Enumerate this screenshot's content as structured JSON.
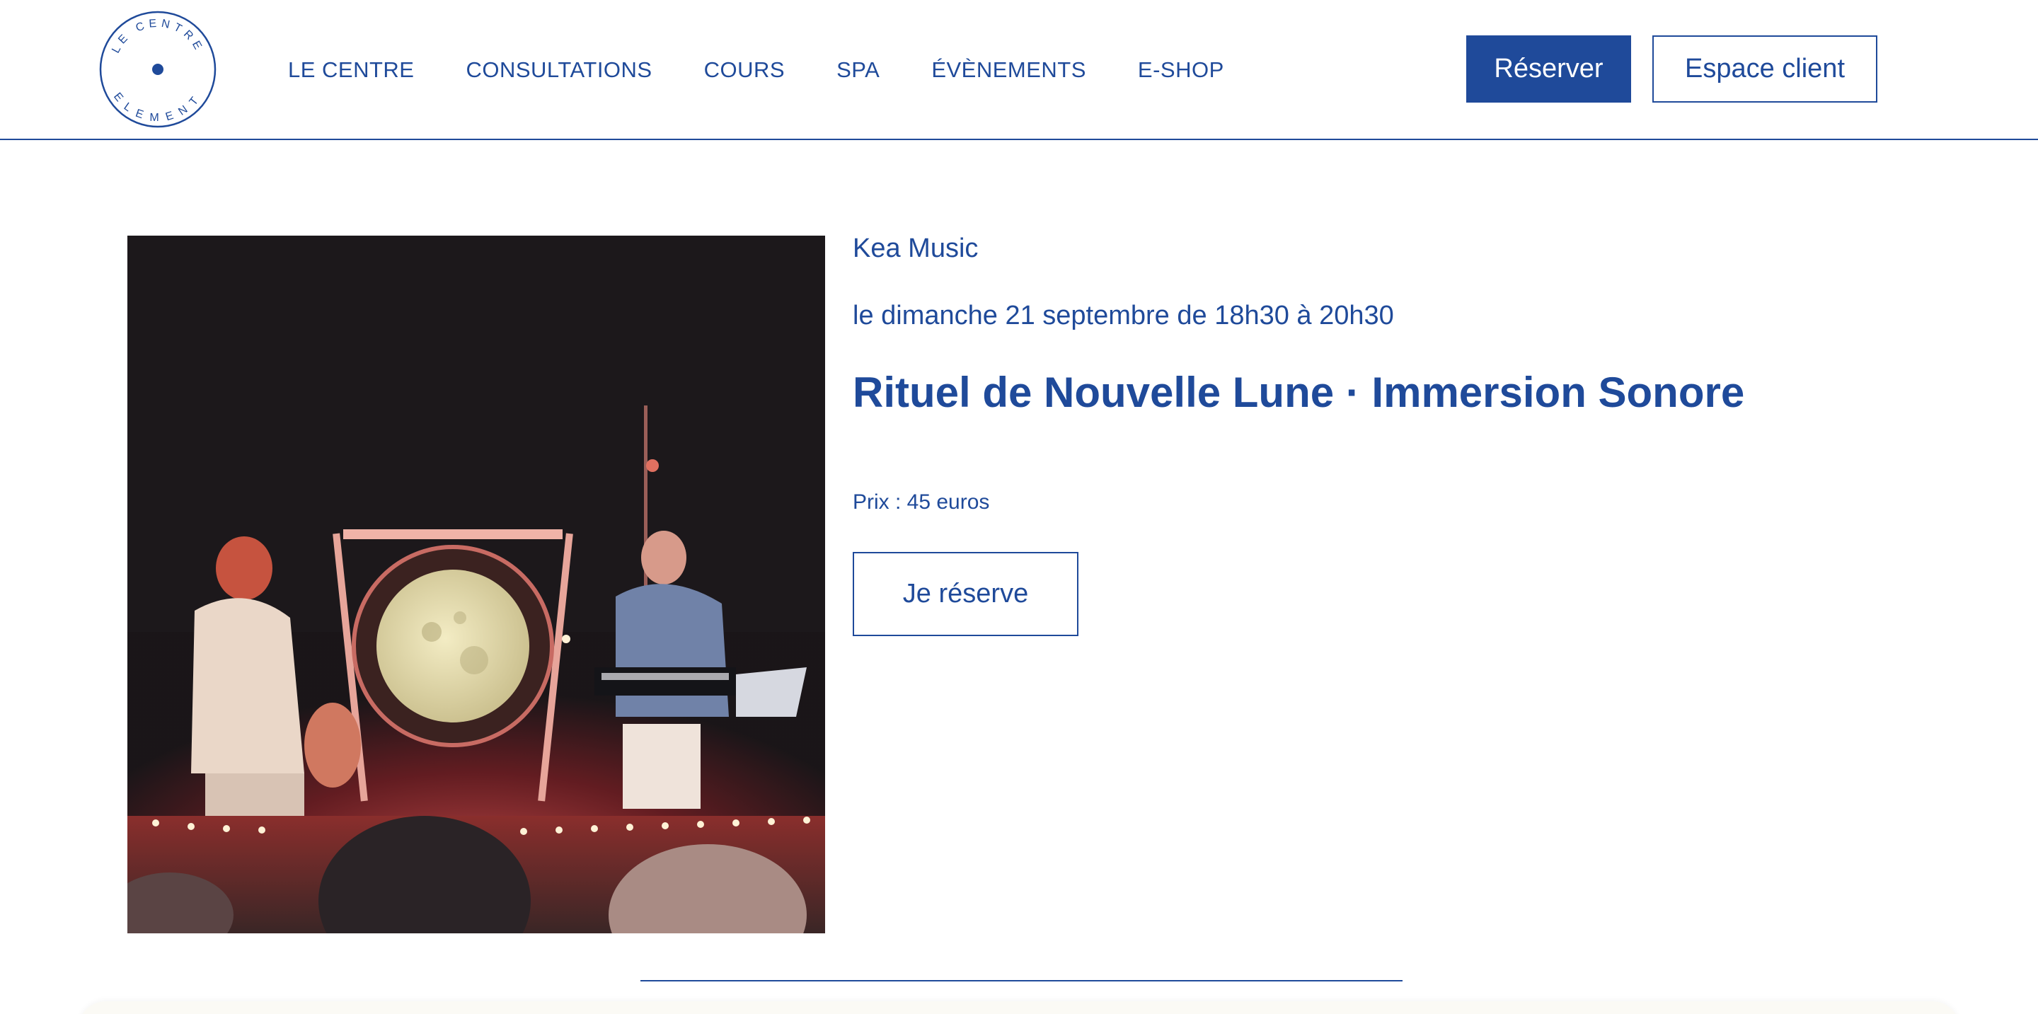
{
  "header": {
    "logo": {
      "text_top": "LE CENTRE",
      "text_bottom": "ELEMENT"
    },
    "nav": [
      {
        "label": "LE CENTRE"
      },
      {
        "label": "CONSULTATIONS"
      },
      {
        "label": "COURS"
      },
      {
        "label": "SPA"
      },
      {
        "label": "ÉVÈNEMENTS"
      },
      {
        "label": "E-SHOP"
      }
    ],
    "reserve_button": "Réserver",
    "client_button": "Espace client"
  },
  "event": {
    "organizer": "Kea Music",
    "date": "le dimanche 21 septembre de 18h30 à 20h30",
    "title": "Rituel de Nouvelle Lune · Immersion Sonore",
    "price": "Prix : 45 euros",
    "cta": "Je réserve"
  },
  "colors": {
    "brand": "#1f4a9a",
    "background": "#ffffff"
  },
  "icons": {
    "logo": "circle-logo-icon"
  }
}
